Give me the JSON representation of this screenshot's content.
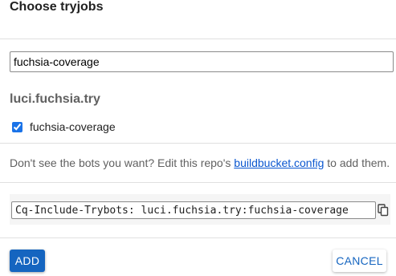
{
  "dialog": {
    "title": "Choose tryjobs",
    "filter": {
      "value": "fuchsia-coverage"
    },
    "bucket": {
      "name": "luci.fuchsia.try",
      "bots": [
        {
          "label": "fuchsia-coverage",
          "checked": true
        }
      ]
    },
    "note": {
      "prefix": "Don't see the bots you want? Edit this repo's ",
      "link_text": "buildbucket.config",
      "suffix": " to add them."
    },
    "footer_line": {
      "value": "Cq-Include-Trybots: luci.fuchsia.try:fuchsia-coverage",
      "copy_icon": "copy-icon"
    },
    "buttons": {
      "add": "ADD",
      "cancel": "CANCEL"
    },
    "colors": {
      "primary": "#1565c0",
      "link": "#0b57d0",
      "muted": "#616161"
    }
  }
}
